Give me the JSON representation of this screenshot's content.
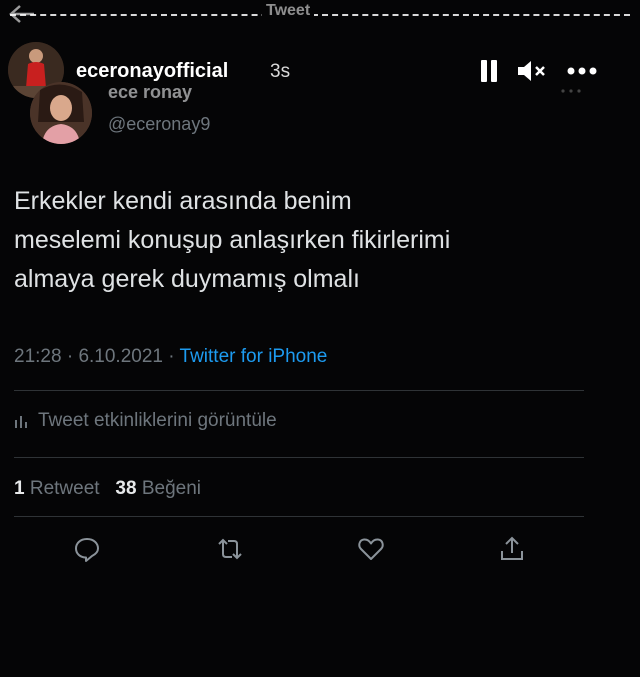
{
  "story_bar": {
    "header_title": "Tweet",
    "username": "eceronayofficial",
    "time_ago": "3s"
  },
  "tweet": {
    "display_name": "ece ronay",
    "handle": "@eceronay9",
    "text_lines": [
      "Erkekler kendi arasında benim",
      "meselemi konuşup anlaşırken fikirlerimi",
      "almaya gerek duymamış olmalı"
    ],
    "time": "21:28",
    "date": "6.10.2021",
    "separator": "·",
    "source": "Twitter for iPhone",
    "activity_label": "Tweet etkinliklerini görüntüle",
    "retweet_count": "1",
    "retweet_label": "Retweet",
    "like_count": "38",
    "like_label": "Beğeni"
  },
  "colors": {
    "background": "#050506",
    "accent": "#1d9bf0",
    "secondary_text": "#6e767d",
    "divider": "#2f3336"
  },
  "icons": {
    "back": "back-arrow-icon",
    "pause": "pause-icon",
    "mute": "mute-icon",
    "more": "more-icon",
    "activity": "bar-chart-icon",
    "reply": "reply-icon",
    "retweet": "retweet-icon",
    "like": "heart-icon",
    "share": "share-icon"
  }
}
